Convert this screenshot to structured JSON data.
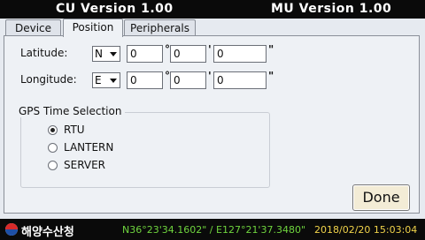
{
  "header": {
    "cu_version": "CU Version 1.00",
    "mu_version": "MU Version 1.00"
  },
  "tabs": [
    {
      "label": "Device"
    },
    {
      "label": "Position"
    },
    {
      "label": "Peripherals"
    }
  ],
  "latitude": {
    "label": "Latitude:",
    "hemisphere": "N",
    "deg": "0",
    "min": "0",
    "sec": "0"
  },
  "longitude": {
    "label": "Longitude:",
    "hemisphere": "E",
    "deg": "0",
    "min": "0",
    "sec": "0"
  },
  "marks": {
    "deg": "°",
    "min": "'",
    "sec": "\""
  },
  "gps": {
    "title": "GPS Time Selection",
    "options": [
      {
        "label": "RTU",
        "checked": true
      },
      {
        "label": "LANTERN",
        "checked": false
      },
      {
        "label": "SERVER",
        "checked": false
      }
    ]
  },
  "done_label": "Done",
  "status": {
    "org": "해양수산청",
    "coordinates": "N36°23'34.1602\" / E127°21'37.3480\"",
    "datetime": "2018/02/20 15:03:04"
  },
  "colors": {
    "coord_green": "#6fd43e",
    "datetime_yellow": "#f0d34a"
  }
}
